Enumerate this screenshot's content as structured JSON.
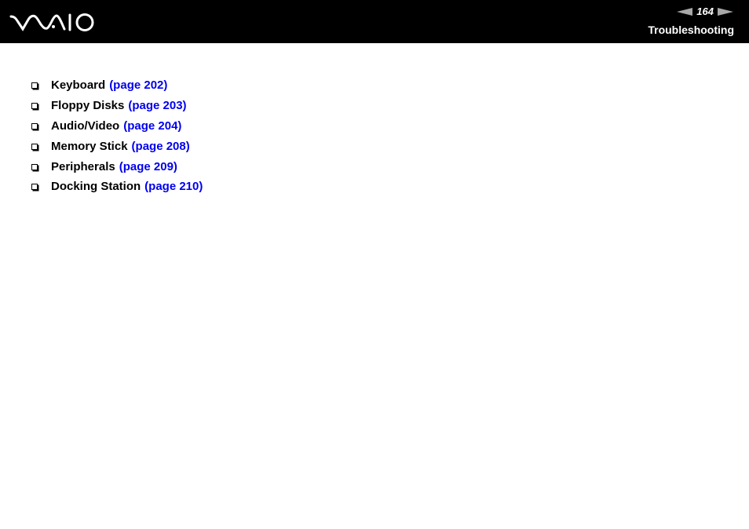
{
  "header": {
    "logo_text": "VAIO",
    "page_number": "164",
    "prev_page_icon": "arrow-left-icon",
    "next_page_icon": "arrow-right-icon",
    "section_title": "Troubleshooting"
  },
  "topics": [
    {
      "label": "Keyboard",
      "link": "(page 202)"
    },
    {
      "label": "Floppy Disks",
      "link": "(page 203)"
    },
    {
      "label": "Audio/Video",
      "link": "(page 204)"
    },
    {
      "label": "Memory Stick",
      "link": "(page 208)"
    },
    {
      "label": "Peripherals",
      "link": "(page 209)"
    },
    {
      "label": "Docking Station",
      "link": "(page 210)"
    }
  ],
  "colors": {
    "header_bg": "#000000",
    "link": "#0000ee",
    "arrow": "#a8a8a8"
  }
}
